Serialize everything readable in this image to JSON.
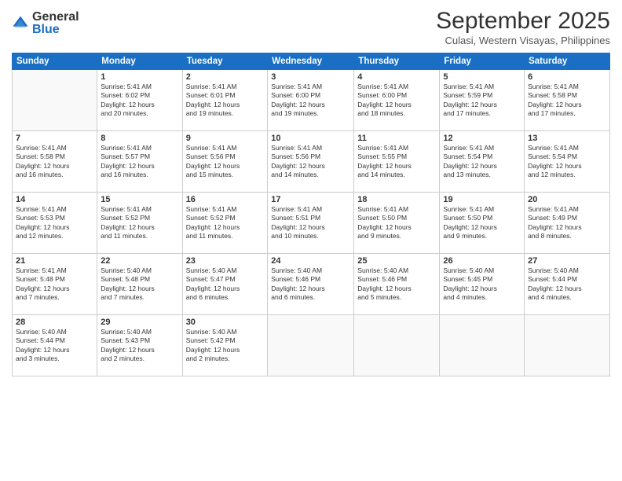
{
  "logo": {
    "general": "General",
    "blue": "Blue"
  },
  "title": "September 2025",
  "subtitle": "Culasi, Western Visayas, Philippines",
  "days_of_week": [
    "Sunday",
    "Monday",
    "Tuesday",
    "Wednesday",
    "Thursday",
    "Friday",
    "Saturday"
  ],
  "weeks": [
    [
      {
        "day": null,
        "info": null
      },
      {
        "day": "1",
        "info": "Sunrise: 5:41 AM\nSunset: 6:02 PM\nDaylight: 12 hours\nand 20 minutes."
      },
      {
        "day": "2",
        "info": "Sunrise: 5:41 AM\nSunset: 6:01 PM\nDaylight: 12 hours\nand 19 minutes."
      },
      {
        "day": "3",
        "info": "Sunrise: 5:41 AM\nSunset: 6:00 PM\nDaylight: 12 hours\nand 19 minutes."
      },
      {
        "day": "4",
        "info": "Sunrise: 5:41 AM\nSunset: 6:00 PM\nDaylight: 12 hours\nand 18 minutes."
      },
      {
        "day": "5",
        "info": "Sunrise: 5:41 AM\nSunset: 5:59 PM\nDaylight: 12 hours\nand 17 minutes."
      },
      {
        "day": "6",
        "info": "Sunrise: 5:41 AM\nSunset: 5:58 PM\nDaylight: 12 hours\nand 17 minutes."
      }
    ],
    [
      {
        "day": "7",
        "info": "Sunrise: 5:41 AM\nSunset: 5:58 PM\nDaylight: 12 hours\nand 16 minutes."
      },
      {
        "day": "8",
        "info": "Sunrise: 5:41 AM\nSunset: 5:57 PM\nDaylight: 12 hours\nand 16 minutes."
      },
      {
        "day": "9",
        "info": "Sunrise: 5:41 AM\nSunset: 5:56 PM\nDaylight: 12 hours\nand 15 minutes."
      },
      {
        "day": "10",
        "info": "Sunrise: 5:41 AM\nSunset: 5:56 PM\nDaylight: 12 hours\nand 14 minutes."
      },
      {
        "day": "11",
        "info": "Sunrise: 5:41 AM\nSunset: 5:55 PM\nDaylight: 12 hours\nand 14 minutes."
      },
      {
        "day": "12",
        "info": "Sunrise: 5:41 AM\nSunset: 5:54 PM\nDaylight: 12 hours\nand 13 minutes."
      },
      {
        "day": "13",
        "info": "Sunrise: 5:41 AM\nSunset: 5:54 PM\nDaylight: 12 hours\nand 12 minutes."
      }
    ],
    [
      {
        "day": "14",
        "info": "Sunrise: 5:41 AM\nSunset: 5:53 PM\nDaylight: 12 hours\nand 12 minutes."
      },
      {
        "day": "15",
        "info": "Sunrise: 5:41 AM\nSunset: 5:52 PM\nDaylight: 12 hours\nand 11 minutes."
      },
      {
        "day": "16",
        "info": "Sunrise: 5:41 AM\nSunset: 5:52 PM\nDaylight: 12 hours\nand 11 minutes."
      },
      {
        "day": "17",
        "info": "Sunrise: 5:41 AM\nSunset: 5:51 PM\nDaylight: 12 hours\nand 10 minutes."
      },
      {
        "day": "18",
        "info": "Sunrise: 5:41 AM\nSunset: 5:50 PM\nDaylight: 12 hours\nand 9 minutes."
      },
      {
        "day": "19",
        "info": "Sunrise: 5:41 AM\nSunset: 5:50 PM\nDaylight: 12 hours\nand 9 minutes."
      },
      {
        "day": "20",
        "info": "Sunrise: 5:41 AM\nSunset: 5:49 PM\nDaylight: 12 hours\nand 8 minutes."
      }
    ],
    [
      {
        "day": "21",
        "info": "Sunrise: 5:41 AM\nSunset: 5:48 PM\nDaylight: 12 hours\nand 7 minutes."
      },
      {
        "day": "22",
        "info": "Sunrise: 5:40 AM\nSunset: 5:48 PM\nDaylight: 12 hours\nand 7 minutes."
      },
      {
        "day": "23",
        "info": "Sunrise: 5:40 AM\nSunset: 5:47 PM\nDaylight: 12 hours\nand 6 minutes."
      },
      {
        "day": "24",
        "info": "Sunrise: 5:40 AM\nSunset: 5:46 PM\nDaylight: 12 hours\nand 6 minutes."
      },
      {
        "day": "25",
        "info": "Sunrise: 5:40 AM\nSunset: 5:46 PM\nDaylight: 12 hours\nand 5 minutes."
      },
      {
        "day": "26",
        "info": "Sunrise: 5:40 AM\nSunset: 5:45 PM\nDaylight: 12 hours\nand 4 minutes."
      },
      {
        "day": "27",
        "info": "Sunrise: 5:40 AM\nSunset: 5:44 PM\nDaylight: 12 hours\nand 4 minutes."
      }
    ],
    [
      {
        "day": "28",
        "info": "Sunrise: 5:40 AM\nSunset: 5:44 PM\nDaylight: 12 hours\nand 3 minutes."
      },
      {
        "day": "29",
        "info": "Sunrise: 5:40 AM\nSunset: 5:43 PM\nDaylight: 12 hours\nand 2 minutes."
      },
      {
        "day": "30",
        "info": "Sunrise: 5:40 AM\nSunset: 5:42 PM\nDaylight: 12 hours\nand 2 minutes."
      },
      {
        "day": null,
        "info": null
      },
      {
        "day": null,
        "info": null
      },
      {
        "day": null,
        "info": null
      },
      {
        "day": null,
        "info": null
      }
    ]
  ]
}
